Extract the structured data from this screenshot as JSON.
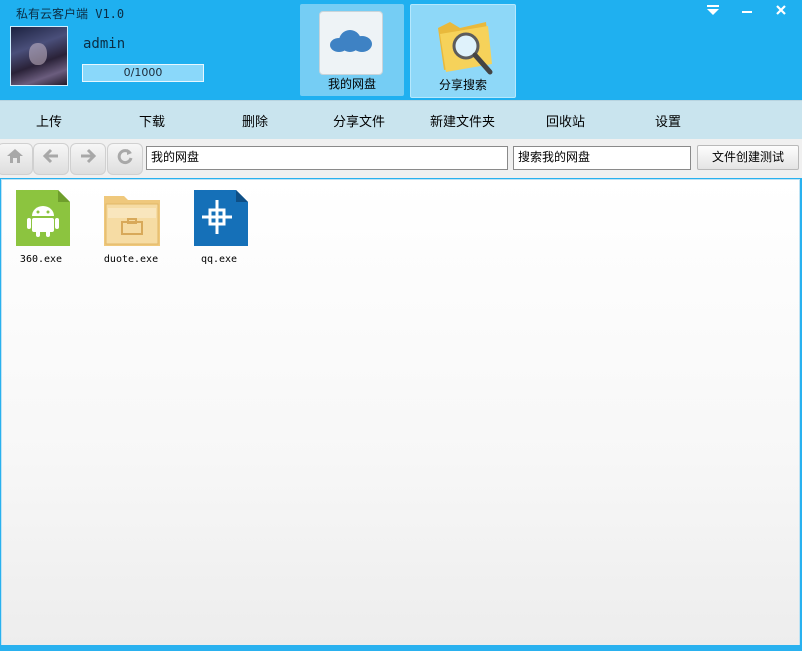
{
  "app": {
    "title": "私有云客户端 V1.0"
  },
  "window_controls": {
    "menu_icon": "menu-down-icon",
    "minimize_icon": "minimize-icon",
    "close_icon": "close-icon"
  },
  "user": {
    "name": "admin",
    "quota_text": "0/1000",
    "quota_used": 0,
    "quota_total": 1000
  },
  "nav_tabs": [
    {
      "label": "我的网盘",
      "icon": "cloud-disk-icon"
    },
    {
      "label": "分享搜索",
      "icon": "folder-search-icon"
    }
  ],
  "toolbar": {
    "items": [
      "上传",
      "下载",
      "删除",
      "分享文件",
      "新建文件夹",
      "回收站",
      "设置"
    ]
  },
  "addressbar": {
    "buttons": [
      "home-icon",
      "back-arrow-icon",
      "forward-arrow-icon",
      "refresh-icon"
    ],
    "path": "我的网盘",
    "search_text": "搜索我的网盘",
    "test_button": "文件创建测试"
  },
  "files": [
    {
      "name": "360.exe",
      "icon": "android-icon"
    },
    {
      "name": "duote.exe",
      "icon": "folder-icon"
    },
    {
      "name": "qq.exe",
      "icon": "crosshair-icon"
    }
  ],
  "colors": {
    "header": "#1fb0f0",
    "toolbar": "#c9e4ee",
    "android": "#8cc43f",
    "folder": "#f2d392",
    "qq": "#1570b8"
  }
}
